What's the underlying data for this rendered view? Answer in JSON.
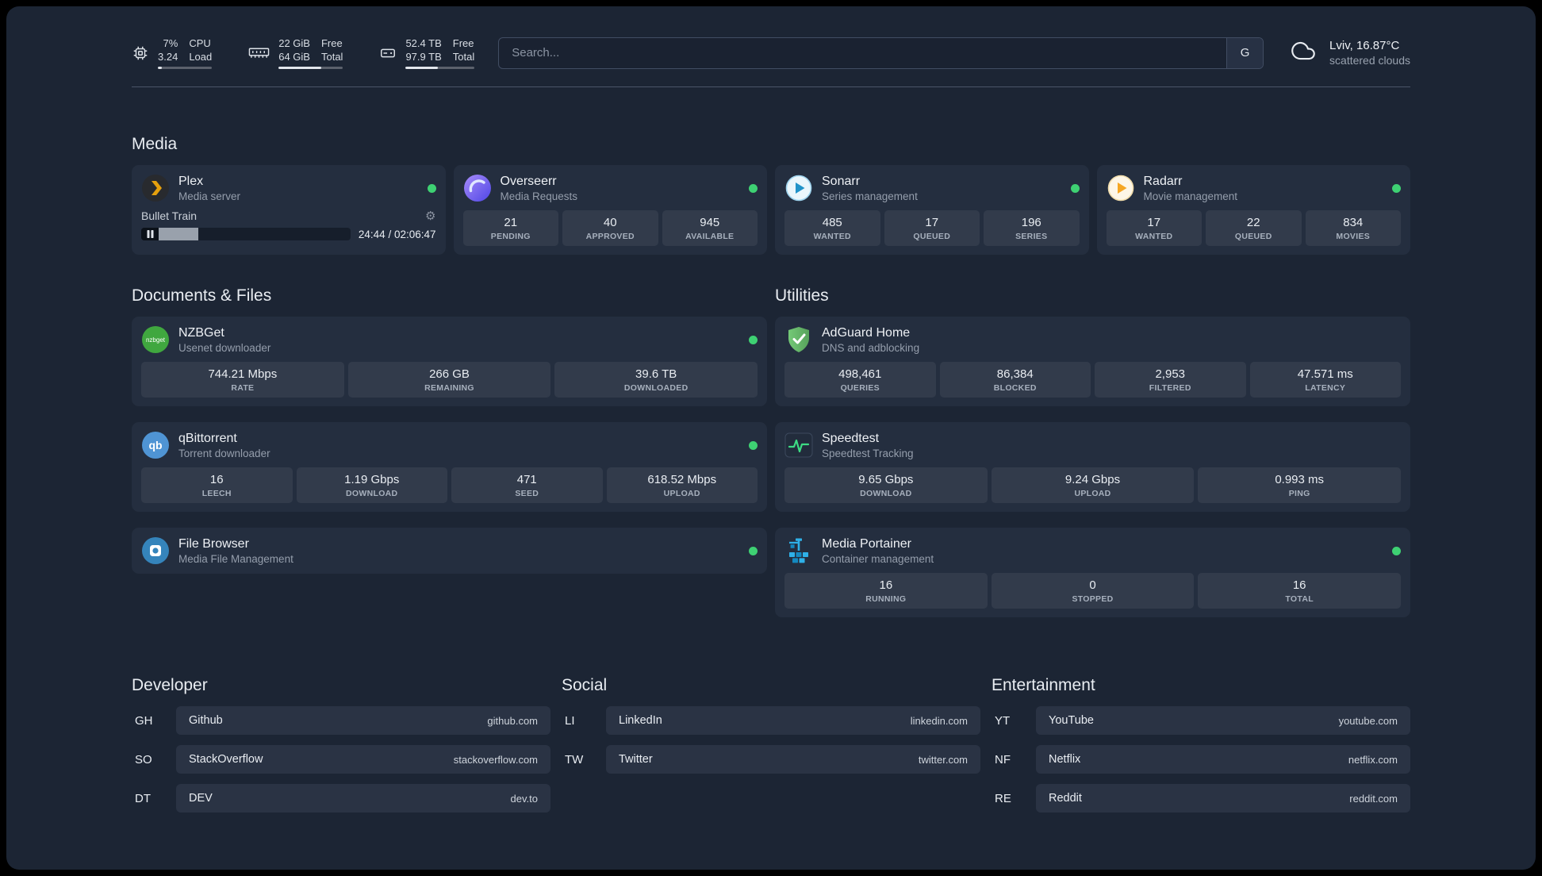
{
  "theme": {
    "background": "#1c2534",
    "card": "#242e3f",
    "stat_block": "#2d3748",
    "status_online": "#3ed173",
    "accent_plex": "#e5a00d",
    "accent_adguard": "#68b873",
    "accent_speedtest": "#3ddc84",
    "accent_portainer": "#2fb1e8"
  },
  "topbar": {
    "resources": [
      {
        "icon": "cpu-icon",
        "values": [
          "7%",
          "3.24"
        ],
        "labels": [
          "CPU",
          "Load"
        ],
        "percent": 7
      },
      {
        "icon": "memory-icon",
        "values": [
          "22 GiB",
          "64 GiB"
        ],
        "labels": [
          "Free",
          "Total"
        ],
        "percent": 66
      },
      {
        "icon": "disk-icon",
        "values": [
          "52.4 TB",
          "97.9 TB"
        ],
        "labels": [
          "Free",
          "Total"
        ],
        "percent": 47
      }
    ],
    "search": {
      "placeholder": "Search...",
      "provider_label": "G"
    },
    "weather": {
      "icon": "cloud-icon",
      "location": "Lviv, 16.87°C",
      "condition": "scattered clouds"
    }
  },
  "sections": {
    "media": "Media",
    "documents": "Documents & Files",
    "utilities": "Utilities"
  },
  "services": {
    "plex": {
      "icon": "plex-icon",
      "name": "Plex",
      "desc": "Media server",
      "now_playing": {
        "title": "Bullet Train",
        "time": "24:44 / 02:06:47",
        "progress_percent": 19
      }
    },
    "overseerr": {
      "icon": "overseerr-icon",
      "name": "Overseerr",
      "desc": "Media Requests",
      "stats": [
        {
          "value": "21",
          "label": "PENDING"
        },
        {
          "value": "40",
          "label": "APPROVED"
        },
        {
          "value": "945",
          "label": "AVAILABLE"
        }
      ]
    },
    "sonarr": {
      "icon": "sonarr-icon",
      "name": "Sonarr",
      "desc": "Series management",
      "stats": [
        {
          "value": "485",
          "label": "WANTED"
        },
        {
          "value": "17",
          "label": "QUEUED"
        },
        {
          "value": "196",
          "label": "SERIES"
        }
      ]
    },
    "radarr": {
      "icon": "radarr-icon",
      "name": "Radarr",
      "desc": "Movie management",
      "stats": [
        {
          "value": "17",
          "label": "WANTED"
        },
        {
          "value": "22",
          "label": "QUEUED"
        },
        {
          "value": "834",
          "label": "MOVIES"
        }
      ]
    },
    "nzbget": {
      "icon": "nzbget-icon",
      "name": "NZBGet",
      "desc": "Usenet downloader",
      "stats": [
        {
          "value": "744.21 Mbps",
          "label": "RATE"
        },
        {
          "value": "266 GB",
          "label": "REMAINING"
        },
        {
          "value": "39.6 TB",
          "label": "DOWNLOADED"
        }
      ]
    },
    "qbittorrent": {
      "icon": "qbittorrent-icon",
      "name": "qBittorrent",
      "desc": "Torrent downloader",
      "stats": [
        {
          "value": "16",
          "label": "LEECH"
        },
        {
          "value": "1.19 Gbps",
          "label": "DOWNLOAD"
        },
        {
          "value": "471",
          "label": "SEED"
        },
        {
          "value": "618.52 Mbps",
          "label": "UPLOAD"
        }
      ]
    },
    "filebrowser": {
      "icon": "filebrowser-icon",
      "name": "File Browser",
      "desc": "Media File Management"
    },
    "adguard": {
      "icon": "adguard-icon",
      "name": "AdGuard Home",
      "desc": "DNS and adblocking",
      "stats": [
        {
          "value": "498,461",
          "label": "QUERIES"
        },
        {
          "value": "86,384",
          "label": "BLOCKED"
        },
        {
          "value": "2,953",
          "label": "FILTERED"
        },
        {
          "value": "47.571 ms",
          "label": "LATENCY"
        }
      ]
    },
    "speedtest": {
      "icon": "speedtest-icon",
      "name": "Speedtest",
      "desc": "Speedtest Tracking",
      "stats": [
        {
          "value": "9.65 Gbps",
          "label": "DOWNLOAD"
        },
        {
          "value": "9.24 Gbps",
          "label": "UPLOAD"
        },
        {
          "value": "0.993 ms",
          "label": "PING"
        }
      ]
    },
    "portainer": {
      "icon": "portainer-icon",
      "name": "Media Portainer",
      "desc": "Container management",
      "stats": [
        {
          "value": "16",
          "label": "RUNNING"
        },
        {
          "value": "0",
          "label": "STOPPED"
        },
        {
          "value": "16",
          "label": "TOTAL"
        }
      ]
    }
  },
  "bookmarks": {
    "developer": {
      "title": "Developer",
      "items": [
        {
          "abbr": "GH",
          "name": "Github",
          "domain": "github.com"
        },
        {
          "abbr": "SO",
          "name": "StackOverflow",
          "domain": "stackoverflow.com"
        },
        {
          "abbr": "DT",
          "name": "DEV",
          "domain": "dev.to"
        }
      ]
    },
    "social": {
      "title": "Social",
      "items": [
        {
          "abbr": "LI",
          "name": "LinkedIn",
          "domain": "linkedin.com"
        },
        {
          "abbr": "TW",
          "name": "Twitter",
          "domain": "twitter.com"
        }
      ]
    },
    "entertainment": {
      "title": "Entertainment",
      "items": [
        {
          "abbr": "YT",
          "name": "YouTube",
          "domain": "youtube.com"
        },
        {
          "abbr": "NF",
          "name": "Netflix",
          "domain": "netflix.com"
        },
        {
          "abbr": "RE",
          "name": "Reddit",
          "domain": "reddit.com"
        }
      ]
    }
  }
}
